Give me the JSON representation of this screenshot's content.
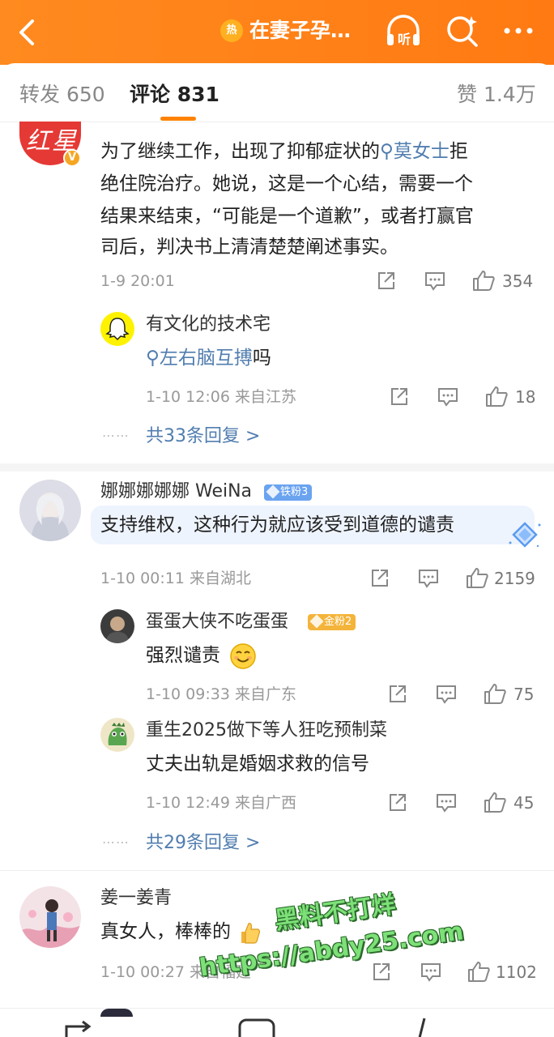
{
  "header": {
    "hot_badge": "热",
    "title": "在妻子孕…",
    "listen_label": "听"
  },
  "tabs": {
    "repost": "转发 650",
    "comments": "评论 831",
    "likes": "赞 1.4万"
  },
  "comments": [
    {
      "text_parts": [
        "为了继续工作，出现了抑郁症状的",
        "莫女士",
        "拒绝住院治疗。她说，这是一个心结，需要一个结果来结束，“可能是一个道歉”，或者打赢官司后，判决书上清清楚楚阐述事实。"
      ],
      "line1_a": "为了继续工作，出现了抑郁症状的",
      "line1_link": "莫女士",
      "line1_b": "拒",
      "line2": "绝住院治疗。她说，这是一个心结，需要一个",
      "line3": "结果来结束，“可能是一个道歉”，或者打赢官",
      "line4": "司后，判决书上清清楚楚阐述事实。",
      "time": "1-9 20:01",
      "likes": "354",
      "replies": [
        {
          "name": "有文化的技术宅",
          "link": "左右脑互搏",
          "text_after": "吗",
          "meta": "1-10 12:06  来自江苏",
          "likes": "18"
        }
      ],
      "more_replies": "共33条回复 >"
    },
    {
      "name": "娜娜娜娜娜 WeiNa",
      "badge": "铁粉3",
      "text": "支持维权，这种行为就应该受到道德的谴责",
      "meta": "1-10 00:11  来自湖北",
      "likes": "2159",
      "replies": [
        {
          "name": "蛋蛋大侠不吃蛋蛋",
          "badge": "金粉2",
          "text": "强烈谴责",
          "meta": "1-10 09:33  来自广东",
          "likes": "75"
        },
        {
          "name": "重生2025做下等人狂吃预制菜",
          "text": "丈夫出轨是婚姻求救的信号",
          "meta": "1-10 12:49  来自广西",
          "likes": "45"
        }
      ],
      "more_replies": "共29条回复 >"
    },
    {
      "name": "姜一姜青",
      "text": "真女人，棒棒的",
      "meta": "1-10 00:27  来自福建",
      "likes": "1102"
    }
  ],
  "watermark": {
    "line1": "黑料不打烊",
    "line2": "https://abdy25.com"
  },
  "colors": {
    "header": "#ff7a12",
    "link": "#507daf",
    "accent": "#ff8200"
  }
}
